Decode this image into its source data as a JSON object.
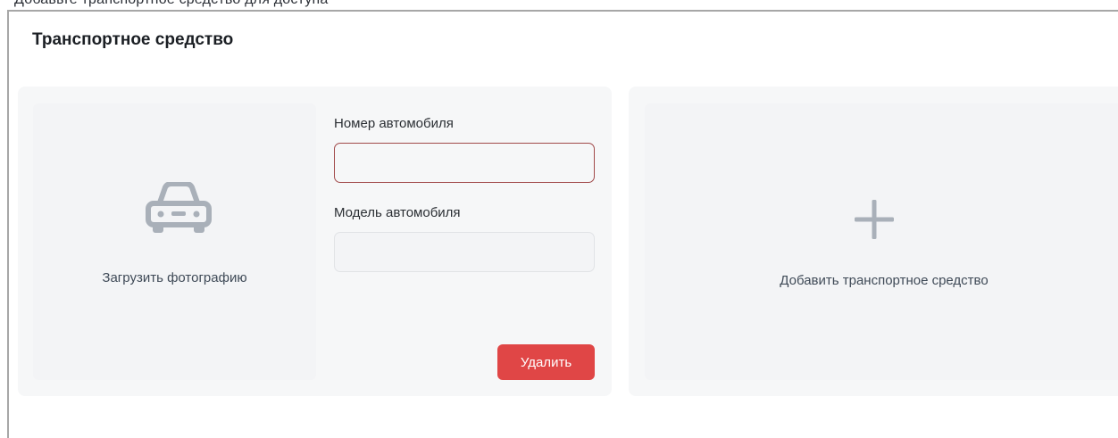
{
  "page": {
    "top_cut_text": "Добавьте транспортное средство для доступа"
  },
  "section": {
    "title": "Транспортное средство"
  },
  "vehicle": {
    "photo_upload_label": "Загрузить фотографию",
    "photo_icon": "car-icon",
    "number_label": "Номер автомобиля",
    "number_value": "",
    "model_label": "Модель автомобиля",
    "model_value": "",
    "delete_label": "Удалить"
  },
  "add_vehicle": {
    "label": "Добавить транспортное средство",
    "icon": "plus-icon"
  },
  "colors": {
    "accent_danger": "#e04646",
    "error_border": "#a14a4a",
    "card_bg": "#f6f7f8",
    "icon_gray": "#a9b0b9"
  }
}
